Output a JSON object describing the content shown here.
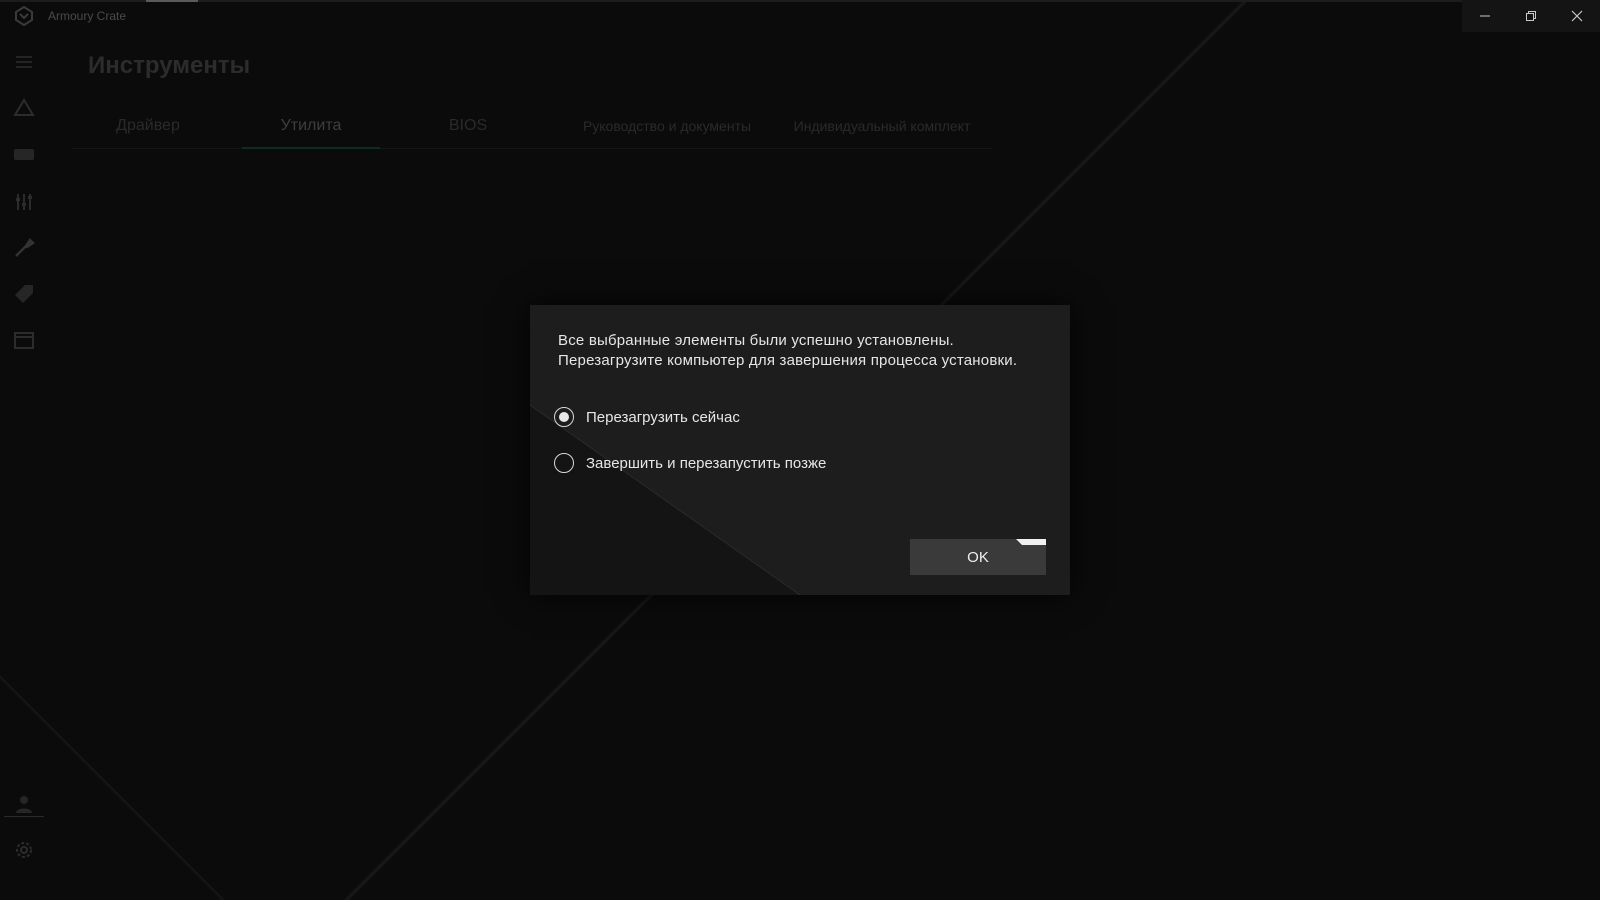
{
  "window": {
    "title": "Armoury Crate",
    "controls": [
      "minimize",
      "restore",
      "close"
    ]
  },
  "sidebar": {
    "items": [
      {
        "icon": "menu-icon"
      },
      {
        "icon": "home-triangle-icon"
      },
      {
        "icon": "device-icon"
      },
      {
        "icon": "sliders-icon"
      },
      {
        "icon": "tools-icon"
      },
      {
        "icon": "tag-icon"
      },
      {
        "icon": "media-icon"
      }
    ],
    "bottom": [
      {
        "icon": "user-icon"
      },
      {
        "icon": "gear-icon"
      }
    ]
  },
  "page": {
    "title": "Инструменты",
    "tabs": [
      {
        "label": "Драйвер"
      },
      {
        "label": "Утилита",
        "active": true
      },
      {
        "label": "BIOS"
      },
      {
        "label": "Руководство и документы"
      },
      {
        "label": "Индивидуальный комплект"
      }
    ]
  },
  "dialog": {
    "message_line1": "Все выбранные элементы были успешно установлены.",
    "message_line2": "Перезагрузите компьютер для завершения процесса установки.",
    "options": [
      {
        "label": "Перезагрузить сейчас",
        "selected": true
      },
      {
        "label": "Завершить и перезапустить позже",
        "selected": false
      }
    ],
    "ok_label": "OK"
  }
}
